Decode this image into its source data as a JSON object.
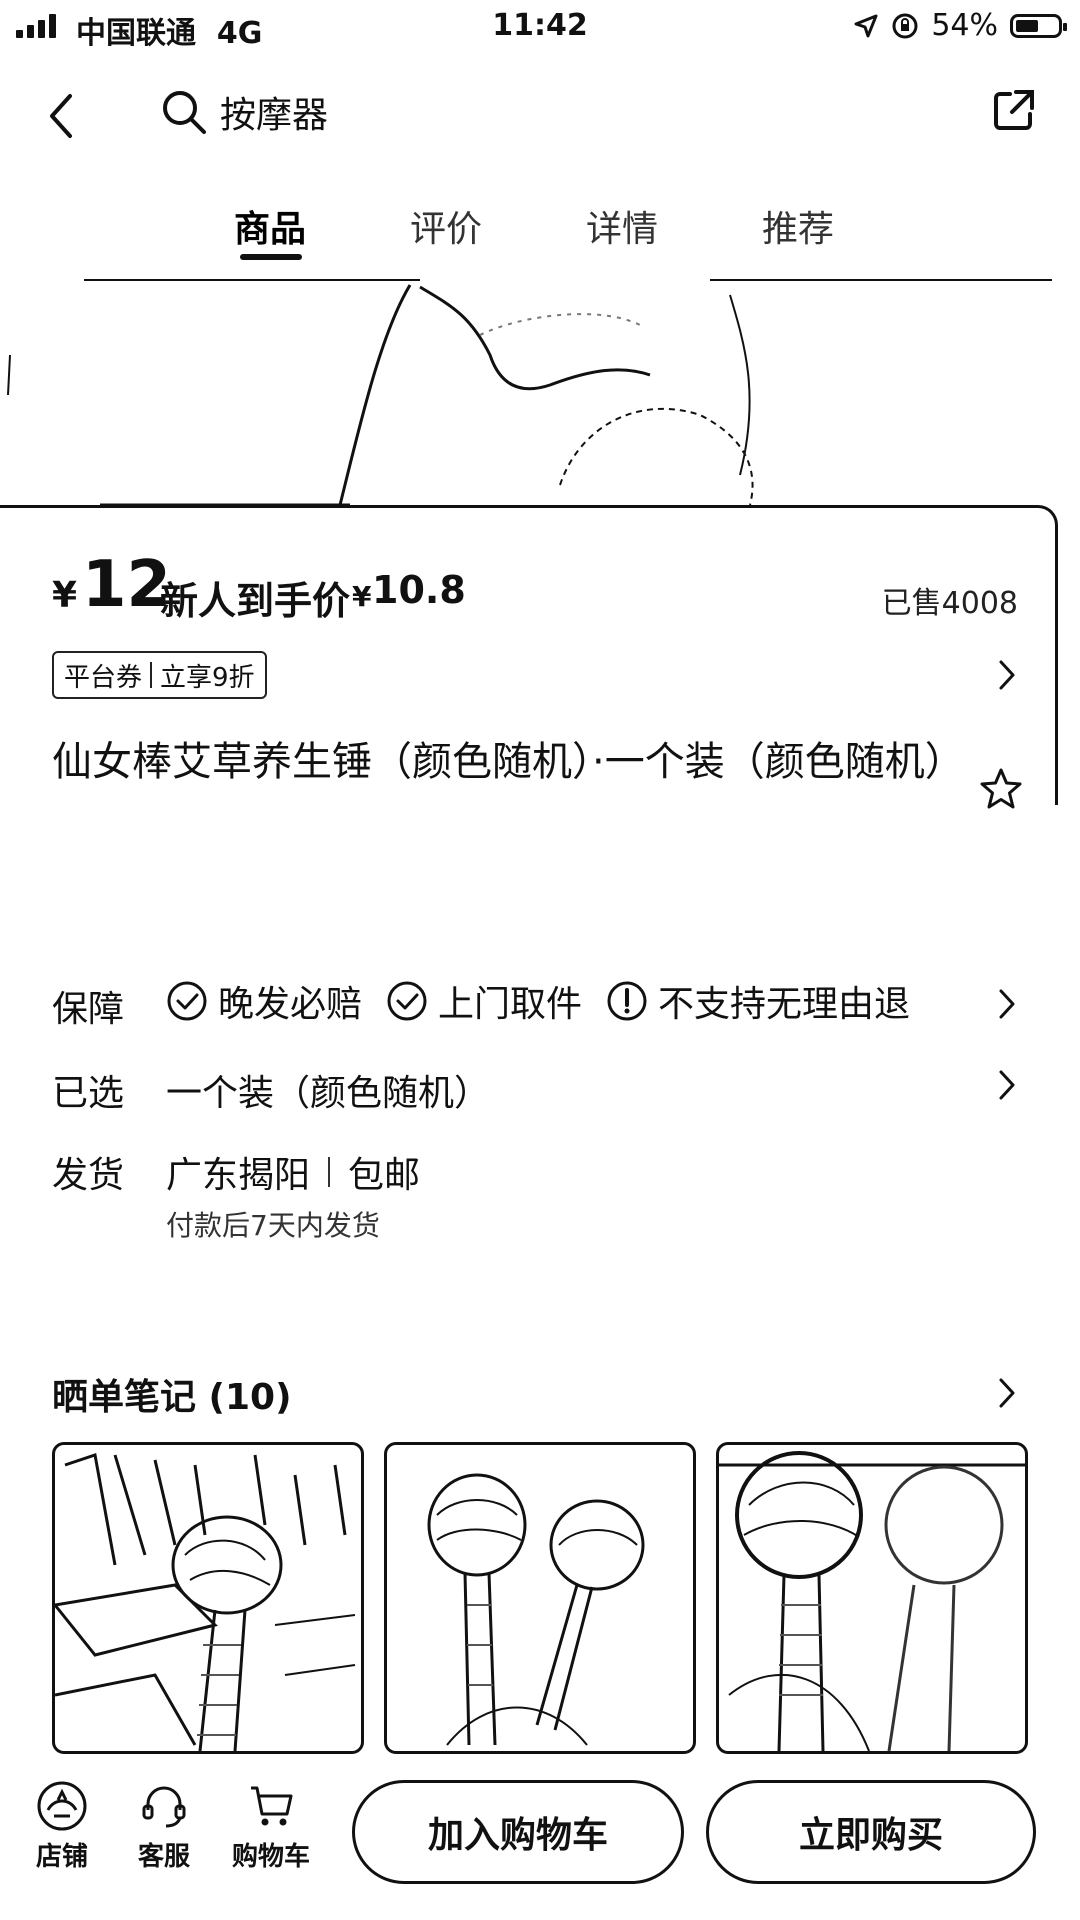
{
  "status_bar": {
    "carrier": "中国联通",
    "network": "4G",
    "time": "11:42",
    "battery": "54%",
    "battery_level": 0.54
  },
  "nav": {
    "search_query": "按摩器"
  },
  "tabs": [
    {
      "label": "商品",
      "active": true
    },
    {
      "label": "评价",
      "active": false
    },
    {
      "label": "详情",
      "active": false
    },
    {
      "label": "推荐",
      "active": false
    }
  ],
  "product": {
    "currency": "¥",
    "price": "12",
    "newuser_label": "新人到手价",
    "newuser_currency": "¥",
    "newuser_price": "10.8",
    "sold": "已售4008",
    "coupon_left": "平台券",
    "coupon_right": "立享9折",
    "title": "仙女棒艾草养生锤（颜色随机）·一个装（颜色随机）"
  },
  "service": {
    "guarantee_label": "保障",
    "guarantees": [
      "晚发必赔",
      "上门取件",
      "不支持无理由退"
    ],
    "selected_label": "已选",
    "selected_value": "一个装（颜色随机）",
    "ship_label": "发货",
    "ship_origin": "广东揭阳",
    "ship_fee": "包邮",
    "ship_note": "付款后7天内发货"
  },
  "notes": {
    "title": "晒单笔记 (10)"
  },
  "bottom_bar": {
    "shop": "店铺",
    "service": "客服",
    "cart": "购物车",
    "add_to_cart": "加入购物车",
    "buy_now": "立即购买"
  }
}
